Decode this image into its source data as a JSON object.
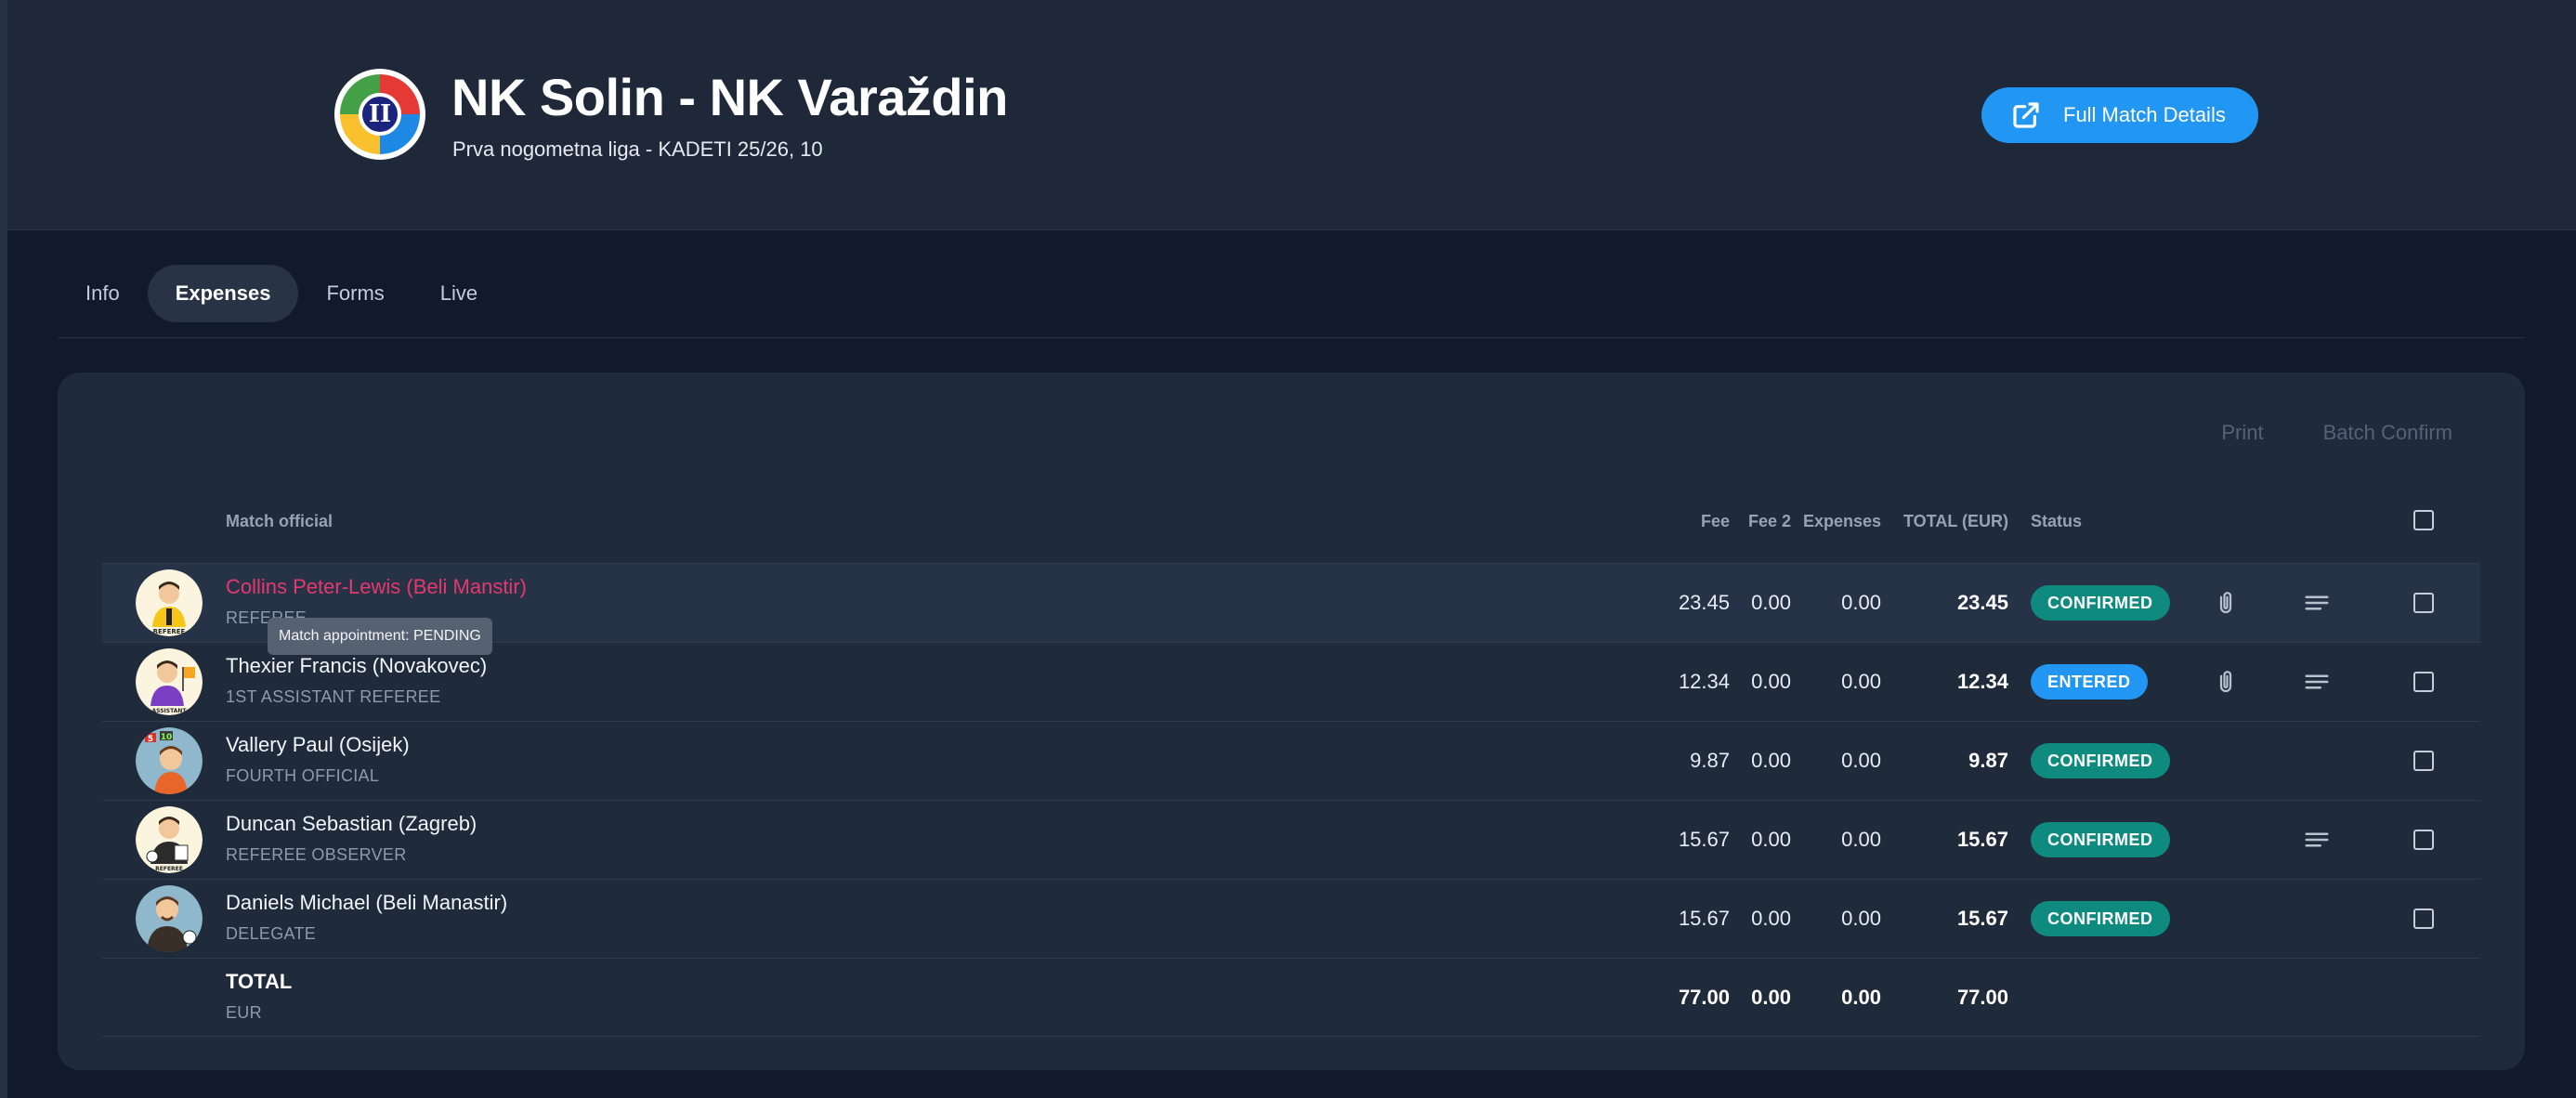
{
  "match": {
    "title": "NK Solin - NK Varaždin",
    "subtitle": "Prva nogometna liga - KADETI 25/26, 10",
    "logo_text": "II",
    "full_details_label": "Full Match Details"
  },
  "tabs": [
    {
      "label": "Info",
      "active": false
    },
    {
      "label": "Expenses",
      "active": true
    },
    {
      "label": "Forms",
      "active": false
    },
    {
      "label": "Live",
      "active": false
    }
  ],
  "actions": {
    "print": "Print",
    "batch_confirm": "Batch Confirm"
  },
  "columns": {
    "official": "Match official",
    "fee": "Fee",
    "fee2": "Fee 2",
    "expenses": "Expenses",
    "total": "TOTAL (EUR)",
    "status": "Status"
  },
  "rows": [
    {
      "name": "Collins Peter-Lewis (Beli Manstir)",
      "role": "REFEREE",
      "fee": "23.45",
      "fee2": "0.00",
      "expenses": "0.00",
      "total": "23.45",
      "status": "CONFIRMED",
      "avatar": "referee-avatar",
      "has_attachment": true,
      "has_notes": true
    },
    {
      "name": "Thexier Francis (Novakovec)",
      "role": "1ST ASSISTANT REFEREE",
      "fee": "12.34",
      "fee2": "0.00",
      "expenses": "0.00",
      "total": "12.34",
      "status": "ENTERED",
      "avatar": "assistant-referee-avatar",
      "has_attachment": true,
      "has_notes": true
    },
    {
      "name": "Vallery Paul (Osijek)",
      "role": "FOURTH OFFICIAL",
      "fee": "9.87",
      "fee2": "0.00",
      "expenses": "0.00",
      "total": "9.87",
      "status": "CONFIRMED",
      "avatar": "fourth-official-avatar",
      "has_attachment": false,
      "has_notes": false
    },
    {
      "name": "Duncan Sebastian (Zagreb)",
      "role": "REFEREE OBSERVER",
      "fee": "15.67",
      "fee2": "0.00",
      "expenses": "0.00",
      "total": "15.67",
      "status": "CONFIRMED",
      "avatar": "referee-observer-avatar",
      "has_attachment": false,
      "has_notes": true
    },
    {
      "name": "Daniels Michael (Beli Manastir)",
      "role": "DELEGATE",
      "fee": "15.67",
      "fee2": "0.00",
      "expenses": "0.00",
      "total": "15.67",
      "status": "CONFIRMED",
      "avatar": "delegate-avatar",
      "has_attachment": false,
      "has_notes": false
    }
  ],
  "totals": {
    "label": "TOTAL",
    "currency": "EUR",
    "fee": "77.00",
    "fee2": "0.00",
    "expenses": "0.00",
    "total": "77.00"
  },
  "tooltip": "Match appointment: PENDING",
  "colors": {
    "accent": "#2196f3",
    "confirmed": "#0f8a7e",
    "entered": "#2196f3",
    "highlight_name": "#e5386f"
  }
}
